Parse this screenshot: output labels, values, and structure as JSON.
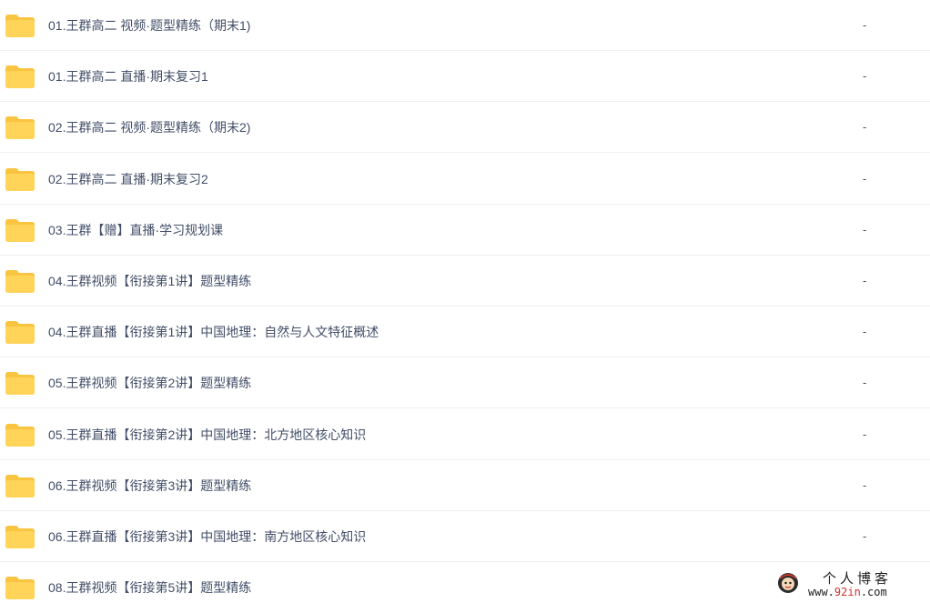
{
  "files": [
    {
      "name": "01.王群高二 视频·题型精练（期末1)",
      "size": "-"
    },
    {
      "name": "01.王群高二 直播·期末复习1",
      "size": "-"
    },
    {
      "name": "02.王群高二 视频·题型精练（期末2)",
      "size": "-"
    },
    {
      "name": "02.王群高二 直播·期末复习2",
      "size": "-"
    },
    {
      "name": "03.王群【赠】直播·学习规划课",
      "size": "-"
    },
    {
      "name": "04.王群视频【衔接第1讲】题型精练",
      "size": "-"
    },
    {
      "name": "04.王群直播【衔接第1讲】中国地理：自然与人文特征概述",
      "size": "-"
    },
    {
      "name": "05.王群视频【衔接第2讲】题型精练",
      "size": "-"
    },
    {
      "name": "05.王群直播【衔接第2讲】中国地理：北方地区核心知识",
      "size": "-"
    },
    {
      "name": "06.王群视频【衔接第3讲】题型精练",
      "size": "-"
    },
    {
      "name": "06.王群直播【衔接第3讲】中国地理：南方地区核心知识",
      "size": "-"
    },
    {
      "name": "08.王群视频【衔接第5讲】题型精练",
      "size": ""
    }
  ],
  "watermark": {
    "title": "个人博客",
    "url_prefix": "www.",
    "url_accent": "92in",
    "url_suffix": ".com"
  },
  "colors": {
    "folder_body": "#ffd459",
    "folder_tab": "#f9c440",
    "text": "#424e67",
    "divider": "#eef0f4"
  },
  "icons": {
    "folder": "folder-icon",
    "mascot": "mascot-logo"
  }
}
